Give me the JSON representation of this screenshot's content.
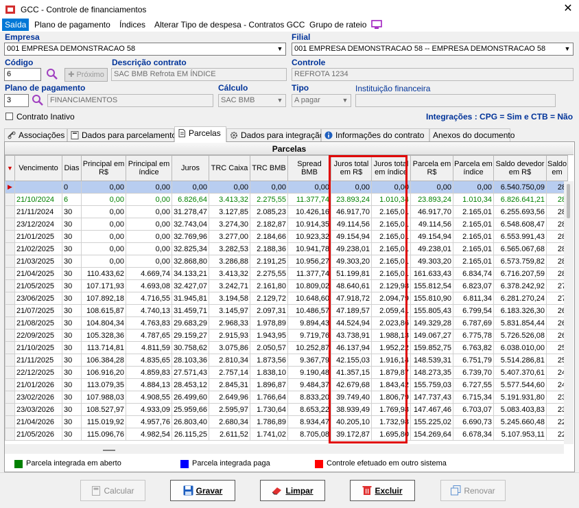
{
  "window": {
    "title": "GCC - Controle de financiamentos",
    "close_glyph": "✕"
  },
  "menu": [
    {
      "label": "Saída",
      "active": true
    },
    {
      "label": "Plano de pagamento"
    },
    {
      "label": "Índices"
    },
    {
      "label": "Alterar Tipo de despesa - Contratos GCC"
    },
    {
      "label": "Grupo de rateio"
    }
  ],
  "form": {
    "empresa": {
      "label": "Empresa",
      "value": "001 EMPRESA DEMONSTRACAO 58"
    },
    "filial": {
      "label": "Filial",
      "value": "001 EMPRESA DEMONSTRACAO 58 -- EMPRESA DEMONSTRACAO 58"
    },
    "codigo": {
      "label": "Código",
      "value": "6"
    },
    "proximo": {
      "label": "Próximo"
    },
    "descricao": {
      "label": "Descrição contrato",
      "value": "SAC BMB Refrota EM ÍNDICE"
    },
    "controle": {
      "label": "Controle",
      "value": "REFROTA 1234"
    },
    "plano": {
      "label": "Plano de pagamento",
      "code": "3",
      "value": "FINANCIAMENTOS"
    },
    "calculo": {
      "label": "Cálculo",
      "value": "SAC BMB"
    },
    "tipo": {
      "label": "Tipo",
      "value": "A pagar"
    },
    "instituicao": {
      "label": "Instituição financeira",
      "value": ""
    },
    "contrato_inativo": {
      "label": "Contrato Inativo",
      "checked": false
    },
    "integracoes": "Integrações : CPG = Sim e CTB = Não"
  },
  "tabs": [
    {
      "label": "Associações",
      "icon": "link-icon"
    },
    {
      "label": "Dados para parcelamento",
      "icon": "calculator-icon"
    },
    {
      "label": "Parcelas",
      "icon": "document-icon",
      "selected": true
    },
    {
      "label": "Dados para integração",
      "icon": "gear-icon"
    },
    {
      "label": "Informações do contrato",
      "icon": "info-icon"
    },
    {
      "label": "Anexos do documento",
      "icon": ""
    }
  ],
  "grid": {
    "caption": "Parcelas",
    "columns": [
      "Vencimento",
      "Dias",
      "Principal em R$",
      "Principal em índice",
      "Juros",
      "TRC Caixa",
      "TRC BMB",
      "Spread BMB",
      "Juros total em R$",
      "Juros total em índice",
      "Parcela em R$",
      "Parcela em índice",
      "Saldo devedor em R$",
      "Saldo em"
    ],
    "rows": [
      [
        "",
        "0",
        "0,00",
        "0,00",
        "0,00",
        "0,00",
        "0,00",
        "0,00",
        "0,00",
        "0,00",
        "0,00",
        "0,00",
        "6.540.750,09",
        "28"
      ],
      [
        "21/10/2024",
        "6",
        "0,00",
        "0,00",
        "6.826,64",
        "3.413,32",
        "2.275,55",
        "11.377,74",
        "23.893,24",
        "1.010,34",
        "23.893,24",
        "1.010,34",
        "6.826.641,21",
        "28"
      ],
      [
        "21/11/2024",
        "30",
        "0,00",
        "0,00",
        "31.278,47",
        "3.127,85",
        "2.085,23",
        "10.426,16",
        "46.917,70",
        "2.165,01",
        "46.917,70",
        "2.165,01",
        "6.255.693,56",
        "28"
      ],
      [
        "23/12/2024",
        "30",
        "0,00",
        "0,00",
        "32.743,04",
        "3.274,30",
        "2.182,87",
        "10.914,35",
        "49.114,56",
        "2.165,01",
        "49.114,56",
        "2.165,01",
        "6.548.608,47",
        "28"
      ],
      [
        "21/01/2025",
        "30",
        "0,00",
        "0,00",
        "32.769,96",
        "3.277,00",
        "2.184,66",
        "10.923,32",
        "49.154,94",
        "2.165,01",
        "49.154,94",
        "2.165,01",
        "6.553.991,43",
        "28"
      ],
      [
        "21/02/2025",
        "30",
        "0,00",
        "0,00",
        "32.825,34",
        "3.282,53",
        "2.188,36",
        "10.941,78",
        "49.238,01",
        "2.165,01",
        "49.238,01",
        "2.165,01",
        "6.565.067,68",
        "28"
      ],
      [
        "21/03/2025",
        "30",
        "0,00",
        "0,00",
        "32.868,80",
        "3.286,88",
        "2.191,25",
        "10.956,27",
        "49.303,20",
        "2.165,01",
        "49.303,20",
        "2.165,01",
        "6.573.759,82",
        "28"
      ],
      [
        "21/04/2025",
        "30",
        "110.433,62",
        "4.669,74",
        "34.133,21",
        "3.413,32",
        "2.275,55",
        "11.377,74",
        "51.199,81",
        "2.165,01",
        "161.633,43",
        "6.834,74",
        "6.716.207,59",
        "28"
      ],
      [
        "21/05/2025",
        "30",
        "107.171,93",
        "4.693,08",
        "32.427,07",
        "3.242,71",
        "2.161,80",
        "10.809,02",
        "48.640,61",
        "2.129,98",
        "155.812,54",
        "6.823,07",
        "6.378.242,92",
        "27"
      ],
      [
        "23/06/2025",
        "30",
        "107.892,18",
        "4.716,55",
        "31.945,81",
        "3.194,58",
        "2.129,72",
        "10.648,60",
        "47.918,72",
        "2.094,79",
        "155.810,90",
        "6.811,34",
        "6.281.270,24",
        "27"
      ],
      [
        "21/07/2025",
        "30",
        "108.615,87",
        "4.740,13",
        "31.459,71",
        "3.145,97",
        "2.097,31",
        "10.486,57",
        "47.189,57",
        "2.059,41",
        "155.805,43",
        "6.799,54",
        "6.183.326,30",
        "26"
      ],
      [
        "21/08/2025",
        "30",
        "104.804,34",
        "4.763,83",
        "29.683,29",
        "2.968,33",
        "1.978,89",
        "9.894,43",
        "44.524,94",
        "2.023,86",
        "149.329,28",
        "6.787,69",
        "5.831.854,44",
        "26"
      ],
      [
        "22/09/2025",
        "30",
        "105.328,36",
        "4.787,65",
        "29.159,27",
        "2.915,93",
        "1.943,95",
        "9.719,76",
        "43.738,91",
        "1.988,13",
        "149.067,27",
        "6.775,78",
        "5.726.526,08",
        "26"
      ],
      [
        "21/10/2025",
        "30",
        "113.714,81",
        "4.811,59",
        "30.758,62",
        "3.075,86",
        "2.050,57",
        "10.252,87",
        "46.137,94",
        "1.952,22",
        "159.852,75",
        "6.763,82",
        "6.038.010,00",
        "25"
      ],
      [
        "21/11/2025",
        "30",
        "106.384,28",
        "4.835,65",
        "28.103,36",
        "2.810,34",
        "1.873,56",
        "9.367,79",
        "42.155,03",
        "1.916,14",
        "148.539,31",
        "6.751,79",
        "5.514.286,81",
        "25"
      ],
      [
        "22/12/2025",
        "30",
        "106.916,20",
        "4.859,83",
        "27.571,43",
        "2.757,14",
        "1.838,10",
        "9.190,48",
        "41.357,15",
        "1.879,87",
        "148.273,35",
        "6.739,70",
        "5.407.370,61",
        "24"
      ],
      [
        "21/01/2026",
        "30",
        "113.079,35",
        "4.884,13",
        "28.453,12",
        "2.845,31",
        "1.896,87",
        "9.484,37",
        "42.679,68",
        "1.843,42",
        "155.759,03",
        "6.727,55",
        "5.577.544,60",
        "24"
      ],
      [
        "23/02/2026",
        "30",
        "107.988,03",
        "4.908,55",
        "26.499,60",
        "2.649,96",
        "1.766,64",
        "8.833,20",
        "39.749,40",
        "1.806,79",
        "147.737,43",
        "6.715,34",
        "5.191.931,80",
        "23"
      ],
      [
        "23/03/2026",
        "30",
        "108.527,97",
        "4.933,09",
        "25.959,66",
        "2.595,97",
        "1.730,64",
        "8.653,22",
        "38.939,49",
        "1.769,98",
        "147.467,46",
        "6.703,07",
        "5.083.403,83",
        "23"
      ],
      [
        "21/04/2026",
        "30",
        "115.019,92",
        "4.957,76",
        "26.803,40",
        "2.680,34",
        "1.786,89",
        "8.934,47",
        "40.205,10",
        "1.732,98",
        "155.225,02",
        "6.690,73",
        "5.245.660,48",
        "22"
      ],
      [
        "21/05/2026",
        "30",
        "115.096,76",
        "4.982,54",
        "26.115,25",
        "2.611,52",
        "1.741,02",
        "8.705,08",
        "39.172,87",
        "1.695,80",
        "154.269,64",
        "6.678,34",
        "5.107.953,11",
        "22"
      ]
    ]
  },
  "legend": [
    {
      "label": "Parcela integrada em aberto",
      "color": "#008000"
    },
    {
      "label": "Parcela integrada paga",
      "color": "#0000ff"
    },
    {
      "label": "Controle efetuado em outro sistema",
      "color": "#ff0000"
    }
  ],
  "buttons": {
    "calcular": "Calcular",
    "gravar": "Gravar",
    "limpar": "Limpar",
    "excluir": "Excluir",
    "renovar": "Renovar"
  },
  "colors": {
    "highlight": "#e00000",
    "selection": "#b8cdf0",
    "accent": "#0078d7",
    "label": "#003399"
  }
}
